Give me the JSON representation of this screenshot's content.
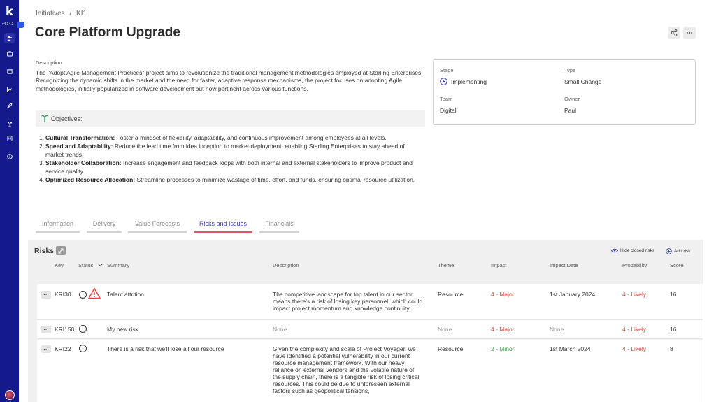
{
  "app": {
    "version": "v4.14.2"
  },
  "breadcrumb": {
    "root": "Initiatives",
    "sep": "/",
    "current": "KI1"
  },
  "title": "Core Platform Upgrade",
  "description": {
    "label": "Description",
    "text": "The \"Adopt Agile Management Practices\" project aims to revolutionize the traditional management methodologies employed at Starling Enterprises. Recognizing the dynamic shifts in the market and the need for faster, adaptive response mechanisms, the project focuses on adopting Agile methodologies, initially popularized in software development but now pertinent across various functions."
  },
  "info": {
    "stage_label": "Stage",
    "stage": "Implementing",
    "type_label": "Type",
    "type": "Small Change",
    "team_label": "Team",
    "team": "Digital",
    "owner_label": "Owner",
    "owner": "Paul"
  },
  "objectives": {
    "title": "Objectives:",
    "items": [
      {
        "num": "1.",
        "head": "Cultural Transformation:",
        "body": " Foster a mindset of flexibility, adaptability, and continuous improvement among employees at all levels."
      },
      {
        "num": "2.",
        "head": "Speed and Adaptability:",
        "body": " Reduce the lead time from idea inception to market deployment, enabling Starling Enterprises to stay ahead of market trends."
      },
      {
        "num": "3.",
        "head": "Stakeholder Collaboration:",
        "body": " Increase engagement and feedback loops with both internal and external stakeholders to improve product and service quality."
      },
      {
        "num": "4.",
        "head": "Optimized Resource Allocation:",
        "body": " Streamline processes to minimize wastage of time, effort, and funds, ensuring optimal resource utilization."
      }
    ]
  },
  "tabs": [
    "Information",
    "Delivery",
    "Value Forecasts",
    "Risks and Issues",
    "Financials"
  ],
  "risks": {
    "title": "Risks",
    "hide_closed": "Hide closed risks",
    "add": "Add risk",
    "columns": [
      "Key",
      "Status",
      "Summary",
      "Description",
      "Theme",
      "Impact",
      "Impact Date",
      "Probability",
      "Score"
    ],
    "rows": [
      {
        "key": "KRI30",
        "summary": "Talent attrition",
        "description": "The competitive landscape for top talent in our sector means there's a risk of losing key personnel, which could impact project momentum and knowledge continuity.",
        "theme": "Resource",
        "impact": "4 - Major",
        "impact_date": "1st January 2024",
        "probability": "4 - Likely",
        "score": "16"
      },
      {
        "key": "KRI150",
        "summary": "My new risk",
        "description": "None",
        "theme": "None",
        "impact": "4 - Major",
        "impact_date": "None",
        "probability": "4 - Likely",
        "score": "16"
      },
      {
        "key": "KRI22",
        "summary": "There is a risk that we'll lose all our resource",
        "description": "Given the complexity and scale of Project Voyager, we have identified a potential vulnerability in our current resource management framework. With our heavy reliance on external vendors and the volatile nature of the supply chain, there is a tangible risk of losing critical resources. This could be due to unforeseen external factors such as geopolitical tensions,",
        "theme": "Resource",
        "impact": "2 - Minor",
        "impact_date": "1st March 2024",
        "probability": "4 - Likely",
        "score": "8"
      }
    ]
  },
  "icons": {
    "nav": [
      "users-icon",
      "briefcase-icon",
      "calendar-icon",
      "chart-icon",
      "rocket-icon",
      "team-icon",
      "building-icon",
      "info-icon"
    ],
    "stage": "play-circle-icon",
    "warning": "warning-triangle-icon"
  },
  "colors": {
    "sidebar": "#141a8c",
    "accent": "#3a3fa8",
    "tab_underline": "#e25563",
    "danger": "#e0443f",
    "success": "#3a9b4a"
  }
}
